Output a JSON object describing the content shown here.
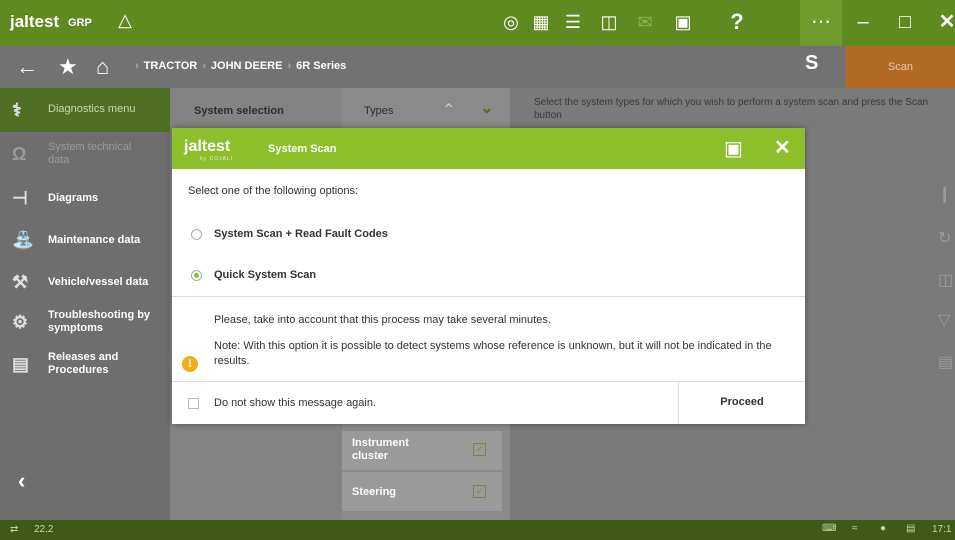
{
  "topbar": {
    "logo": "jaltest",
    "group": "GRP",
    "icons": [
      "network-icon",
      "document-icon",
      "list-icon",
      "trash-icon",
      "mail-icon",
      "camera-icon",
      "help-icon",
      "apps-icon"
    ],
    "window_controls": [
      "minimize-icon",
      "maximize-icon",
      "close-icon"
    ]
  },
  "navbar": {
    "breadcrumb": [
      "TRACTOR",
      "JOHN DEERE",
      "6R Series"
    ],
    "scan_label": "Scan"
  },
  "sidebar": {
    "items": [
      {
        "label": "Diagnostics menu",
        "icon": "diagnostics-icon"
      },
      {
        "label": "System technical data",
        "icon": "technical-data-icon"
      },
      {
        "label": "Diagrams",
        "icon": "diagram-icon"
      },
      {
        "label": "Maintenance data",
        "icon": "oil-can-icon"
      },
      {
        "label": "Vehicle/vessel data",
        "icon": "wrench-icon"
      },
      {
        "label": "Troubleshooting by symptoms",
        "icon": "troubleshooting-icon"
      },
      {
        "label": "Releases and Procedures",
        "icon": "procedures-icon"
      }
    ]
  },
  "main": {
    "system_selection_header": "System selection",
    "types_header": "Types",
    "instructions": "Select the system types for which you wish to perform a system scan and press the Scan button",
    "type_items": [
      {
        "label": "Instrument cluster",
        "checked": true
      },
      {
        "label": "Steering",
        "checked": true
      }
    ]
  },
  "modal": {
    "logo": "jaltest",
    "logo_sub": "by COJALI",
    "title": "System Scan",
    "prompt": "Select one of the following options:",
    "options": [
      {
        "label": "System Scan + Read Fault Codes",
        "selected": false
      },
      {
        "label": "Quick System Scan",
        "selected": true
      }
    ],
    "warning_line1": "Please, take into account that this process may take several minutes.",
    "warning_line2": "Note: With this option it is possible to detect systems whose reference is unknown, but it will not be indicated in the results.",
    "checkbox_label": "Do not show this message again.",
    "proceed_label": "Proceed"
  },
  "statusbar": {
    "version": "22.2",
    "time": "17:1"
  },
  "colors": {
    "brand_green": "#8cbf2a",
    "dark_green": "#5e8a1f",
    "scan_orange": "#b36a25",
    "warning": "#f0ad1c"
  }
}
